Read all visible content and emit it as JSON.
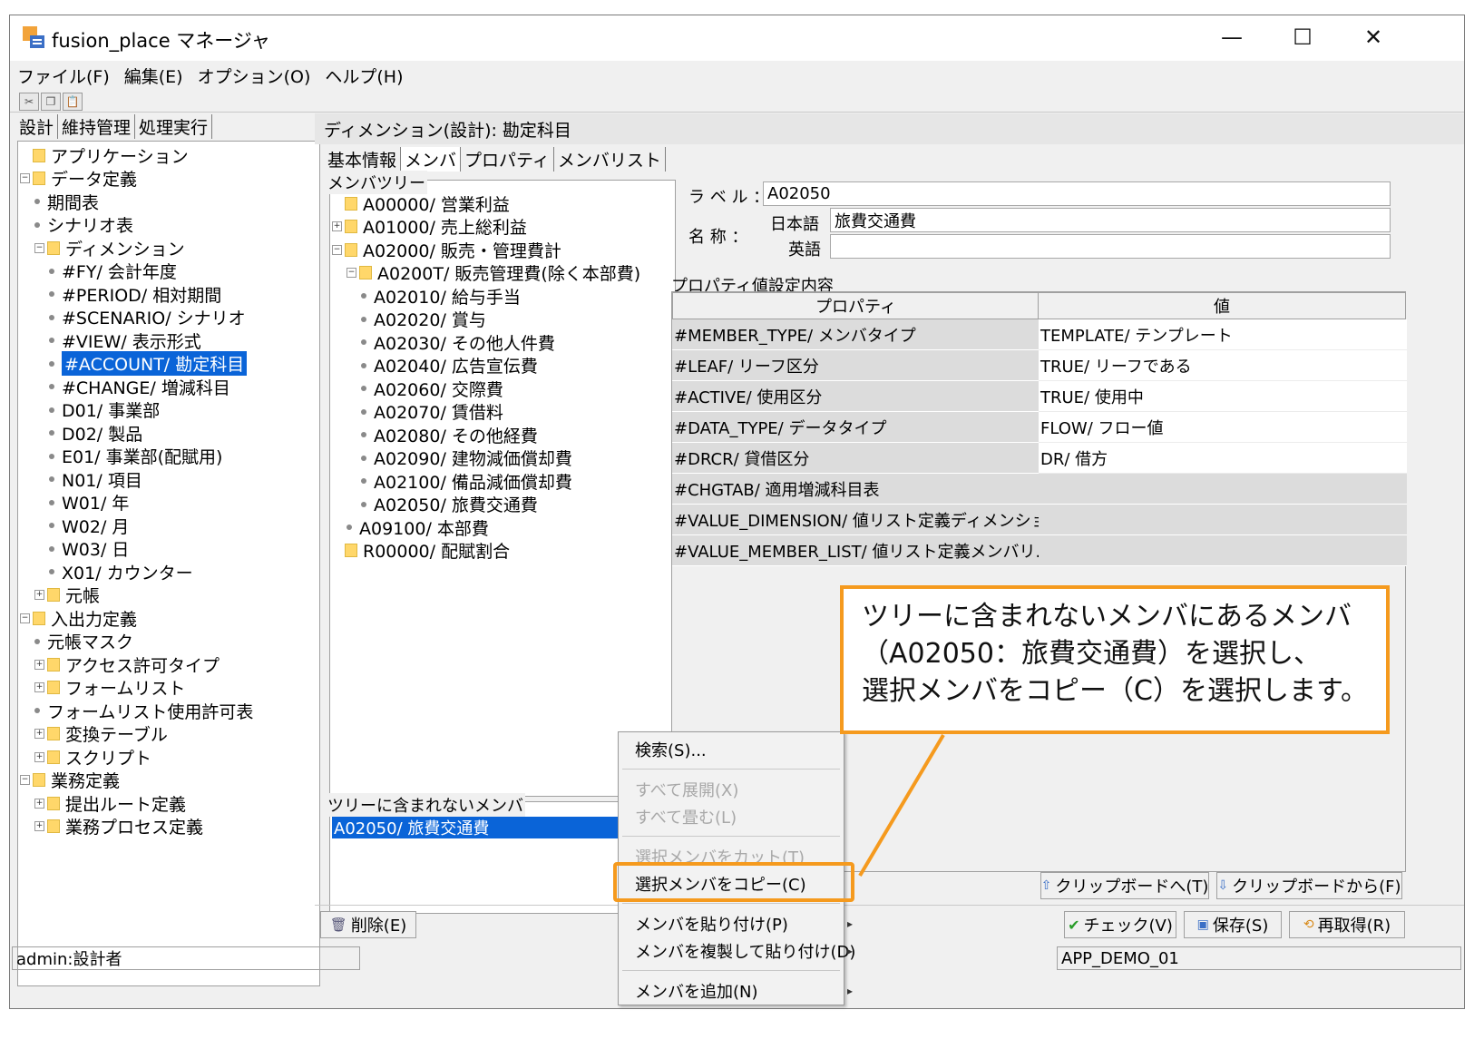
{
  "window": {
    "title": "fusion_place マネージャ",
    "minimize": "—",
    "maximize": "☐",
    "close": "✕"
  },
  "menubar": [
    "ファイル(F)",
    "編集(E)",
    "オプション(O)",
    "ヘルプ(H)"
  ],
  "left_tabs": [
    "設計",
    "維持管理",
    "処理実行"
  ],
  "left_tree": [
    {
      "label": "アプリケーション",
      "level": 0,
      "kind": "folder",
      "pm": ""
    },
    {
      "label": "データ定義",
      "level": 0,
      "kind": "folder",
      "pm": "−"
    },
    {
      "label": "期間表",
      "level": 1,
      "kind": "leaf"
    },
    {
      "label": "シナリオ表",
      "level": 1,
      "kind": "leaf"
    },
    {
      "label": "ディメンション",
      "level": 1,
      "kind": "folder",
      "pm": "−"
    },
    {
      "label": "#FY/ 会計年度",
      "level": 2,
      "kind": "leaf"
    },
    {
      "label": "#PERIOD/ 相対期間",
      "level": 2,
      "kind": "leaf"
    },
    {
      "label": "#SCENARIO/ シナリオ",
      "level": 2,
      "kind": "leaf"
    },
    {
      "label": "#VIEW/ 表示形式",
      "level": 2,
      "kind": "leaf"
    },
    {
      "label": "#ACCOUNT/ 勘定科目",
      "level": 2,
      "kind": "leaf",
      "selected": true
    },
    {
      "label": "#CHANGE/ 増減科目",
      "level": 2,
      "kind": "leaf"
    },
    {
      "label": "D01/ 事業部",
      "level": 2,
      "kind": "leaf"
    },
    {
      "label": "D02/ 製品",
      "level": 2,
      "kind": "leaf"
    },
    {
      "label": "E01/ 事業部(配賦用)",
      "level": 2,
      "kind": "leaf"
    },
    {
      "label": "N01/ 項目",
      "level": 2,
      "kind": "leaf"
    },
    {
      "label": "W01/ 年",
      "level": 2,
      "kind": "leaf"
    },
    {
      "label": "W02/ 月",
      "level": 2,
      "kind": "leaf"
    },
    {
      "label": "W03/ 日",
      "level": 2,
      "kind": "leaf"
    },
    {
      "label": "X01/ カウンター",
      "level": 2,
      "kind": "leaf"
    },
    {
      "label": "元帳",
      "level": 1,
      "kind": "folder",
      "pm": "+"
    },
    {
      "label": "入出力定義",
      "level": 0,
      "kind": "folder",
      "pm": "−"
    },
    {
      "label": "元帳マスク",
      "level": 1,
      "kind": "leaf"
    },
    {
      "label": "アクセス許可タイプ",
      "level": 1,
      "kind": "folder",
      "pm": "+"
    },
    {
      "label": "フォームリスト",
      "level": 1,
      "kind": "folder",
      "pm": "+"
    },
    {
      "label": "フォームリスト使用許可表",
      "level": 1,
      "kind": "leaf"
    },
    {
      "label": "変換テーブル",
      "level": 1,
      "kind": "folder",
      "pm": "+"
    },
    {
      "label": "スクリプト",
      "level": 1,
      "kind": "folder",
      "pm": "+"
    },
    {
      "label": "業務定義",
      "level": 0,
      "kind": "folder",
      "pm": "−"
    },
    {
      "label": "提出ルート定義",
      "level": 1,
      "kind": "folder",
      "pm": "+"
    },
    {
      "label": "業務プロセス定義",
      "level": 1,
      "kind": "folder",
      "pm": "+"
    }
  ],
  "right_header": "ディメンション(設計): 勘定科目",
  "inner_tabs": [
    "基本情報",
    "メンバ",
    "プロパティ",
    "メンバリスト"
  ],
  "member_tree_title": "メンバツリー",
  "member_tree": [
    {
      "label": "A00000/ 営業利益",
      "level": 0,
      "kind": "folder",
      "pm": ""
    },
    {
      "label": "A01000/ 売上総利益",
      "level": 0,
      "kind": "folder",
      "pm": "+"
    },
    {
      "label": "A02000/ 販売・管理費計",
      "level": 0,
      "kind": "folder",
      "pm": "−"
    },
    {
      "label": "A0200T/ 販売管理費(除く本部費)",
      "level": 1,
      "kind": "folder",
      "pm": "−"
    },
    {
      "label": "A02010/ 給与手当",
      "level": 2,
      "kind": "leaf"
    },
    {
      "label": "A02020/ 賞与",
      "level": 2,
      "kind": "leaf"
    },
    {
      "label": "A02030/ その他人件費",
      "level": 2,
      "kind": "leaf"
    },
    {
      "label": "A02040/ 広告宣伝費",
      "level": 2,
      "kind": "leaf"
    },
    {
      "label": "A02060/ 交際費",
      "level": 2,
      "kind": "leaf"
    },
    {
      "label": "A02070/ 賃借料",
      "level": 2,
      "kind": "leaf"
    },
    {
      "label": "A02080/ その他経費",
      "level": 2,
      "kind": "leaf"
    },
    {
      "label": "A02090/ 建物減価償却費",
      "level": 2,
      "kind": "leaf"
    },
    {
      "label": "A02100/ 備品減価償却費",
      "level": 2,
      "kind": "leaf"
    },
    {
      "label": "A02050/ 旅費交通費",
      "level": 2,
      "kind": "leaf"
    },
    {
      "label": "A09100/ 本部費",
      "level": 1,
      "kind": "leaf"
    },
    {
      "label": "R00000/ 配賦割合",
      "level": 0,
      "kind": "folder",
      "pm": ""
    }
  ],
  "notin_title": "ツリーに含まれないメンバ",
  "notin_selected": "A02050/ 旅費交通費",
  "label_field": {
    "label": "ラ ベ ル ：",
    "value": "A02050"
  },
  "name_field": {
    "label": "名 称 ：",
    "ja_label": "日本語",
    "ja_value": "旅費交通費",
    "en_label": "英語",
    "en_value": ""
  },
  "prop_title": "プロパティ値設定内容",
  "prop_headers": [
    "プロパティ",
    "値"
  ],
  "props": [
    {
      "name": "#MEMBER_TYPE/ メンバタイプ",
      "value": "TEMPLATE/ テンプレート",
      "gray": false
    },
    {
      "name": "#LEAF/ リーフ区分",
      "value": "TRUE/ リーフである",
      "gray": false
    },
    {
      "name": "#ACTIVE/ 使用区分",
      "value": "TRUE/ 使用中",
      "gray": false
    },
    {
      "name": "#DATA_TYPE/ データタイプ",
      "value": "FLOW/ フロー値",
      "gray": false
    },
    {
      "name": "#DRCR/ 貸借区分",
      "value": "DR/ 借方",
      "gray": false
    },
    {
      "name": "#CHGTAB/ 適用増減科目表",
      "value": "",
      "gray": true
    },
    {
      "name": "#VALUE_DIMENSION/ 値リスト定義ディメンショ...",
      "value": "",
      "gray": true
    },
    {
      "name": "#VALUE_MEMBER_LIST/ 値リスト定義メンバリ...",
      "value": "",
      "gray": true
    }
  ],
  "buttons": {
    "clip_to": "クリップボードへ(T)",
    "clip_from": "クリップボードから(F)",
    "delete": "削除(E)",
    "check": "チェック(V)",
    "save": "保存(S)",
    "reload": "再取得(R)"
  },
  "status": {
    "user": "admin:設計者",
    "app": "APP_DEMO_01"
  },
  "context_menu": [
    {
      "label": "検索(S)...",
      "disabled": false,
      "sub": false
    },
    {
      "label": "すべて展開(X)",
      "disabled": true,
      "sub": false
    },
    {
      "label": "すべて畳む(L)",
      "disabled": true,
      "sub": false
    },
    {
      "label": "選択メンバをカット(T)",
      "disabled": true,
      "sub": false
    },
    {
      "label": "選択メンバをコピー(C)",
      "disabled": false,
      "sub": false
    },
    {
      "label": "メンバを貼り付け(P)",
      "disabled": false,
      "sub": true
    },
    {
      "label": "メンバを複製して貼り付け(D)",
      "disabled": false,
      "sub": true
    },
    {
      "label": "メンバを追加(N)",
      "disabled": false,
      "sub": true
    }
  ],
  "callout": [
    "ツリーに含まれないメンバにあるメンバ",
    "（A02050：旅費交通費）を選択し、",
    "選択メンバをコピー（C）を選択します。"
  ],
  "colors": {
    "accent": "#f59a1e",
    "selection": "#0a64d8"
  }
}
